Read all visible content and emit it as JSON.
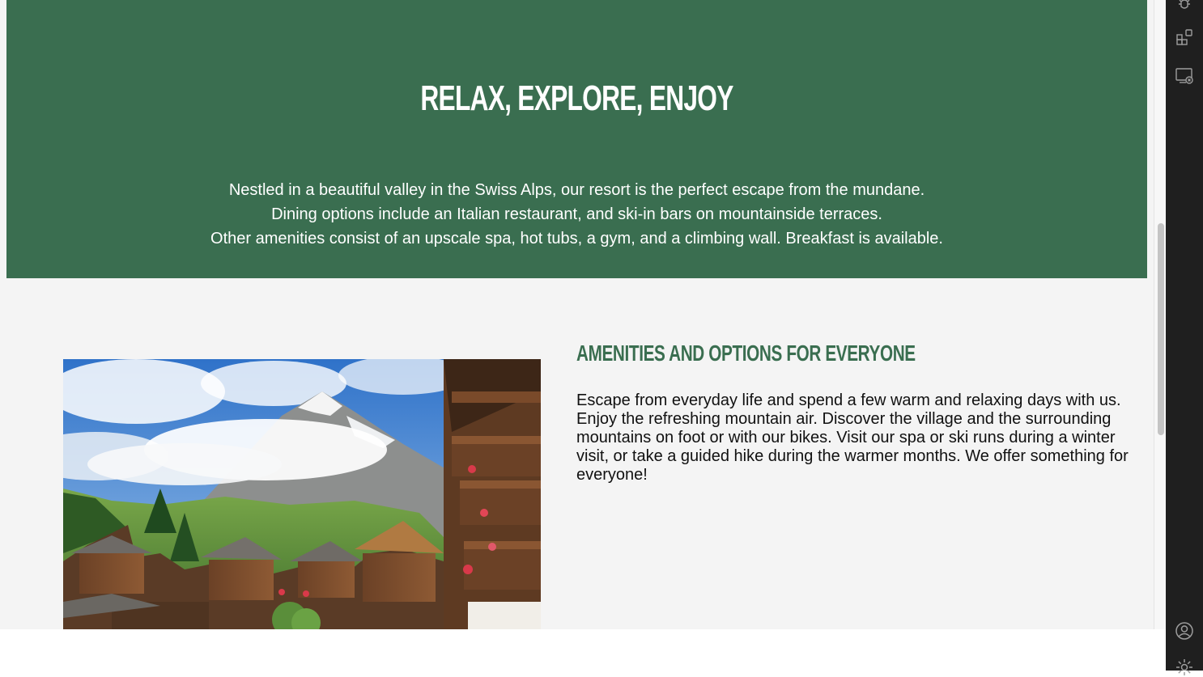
{
  "hero": {
    "title": "RELAX, EXPLORE, ENJOY",
    "lines": [
      "Nestled in a beautiful valley in the Swiss Alps, our resort is the perfect escape from the mundane.",
      "Dining options include an Italian restaurant, and ski-in bars on mountainside terraces.",
      "Other amenities consist of an upscale spa, hot tubs, a gym, and a climbing wall. Breakfast is available."
    ]
  },
  "amenities": {
    "heading": "AMENITIES AND OPTIONS FOR EVERYONE",
    "body": "Escape from everyday life and spend a few warm and relaxing days with us. Enjoy the refreshing mountain air. Discover the village and the surrounding mountains on foot or with our bikes. Visit our spa or ski runs during a winter visit, or take a guided hike during the warmer months. We offer something for everyone!"
  },
  "activity_bar": {
    "icons": [
      "debug-icon",
      "extensions-icon",
      "remote-explorer-icon",
      "accounts-icon",
      "settings-gear-icon"
    ]
  },
  "colors": {
    "brand_green": "#3a6e50",
    "page_background": "#f4f4f4",
    "activity_bar": "#1f1f1f"
  }
}
